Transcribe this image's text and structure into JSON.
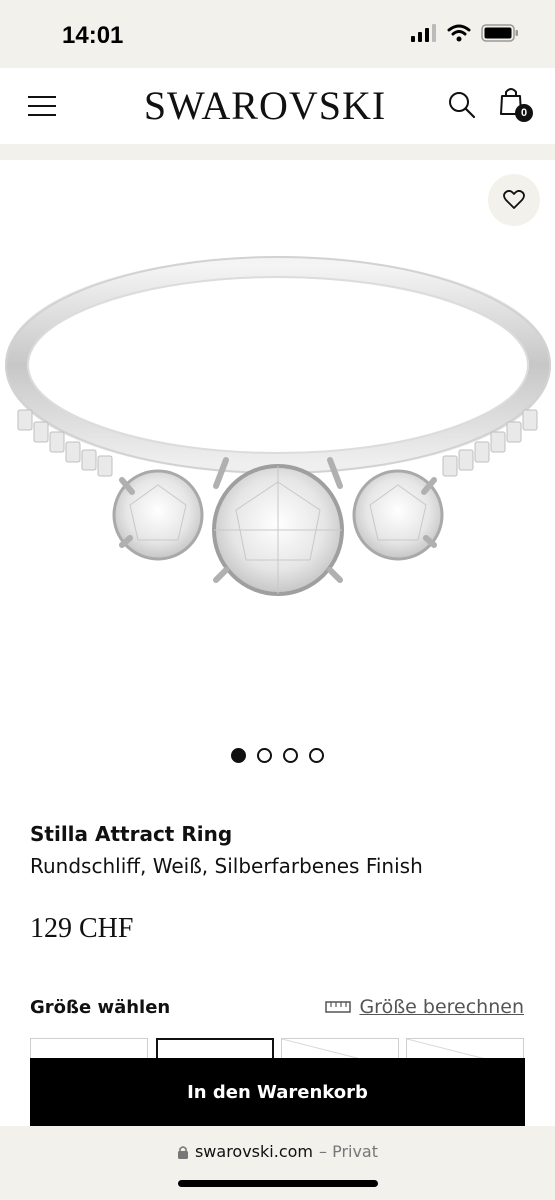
{
  "status_bar": {
    "time": "14:01"
  },
  "header": {
    "logo": "SWAROVSKI",
    "cart_count": "0"
  },
  "carousel": {
    "total": 4,
    "active_index": 0
  },
  "product": {
    "name": "Stilla Attract Ring",
    "subtitle": "Rundschliff, Weiß, Silberfarbenes Finish",
    "price": "129 CHF"
  },
  "size": {
    "label": "Größe wählen",
    "calculator_link": "Größe berechnen",
    "options_selected_index": 1
  },
  "cart": {
    "button_label": "In den Warenkorb"
  },
  "url_bar": {
    "domain": "swarovski.com",
    "mode": "– Privat"
  }
}
